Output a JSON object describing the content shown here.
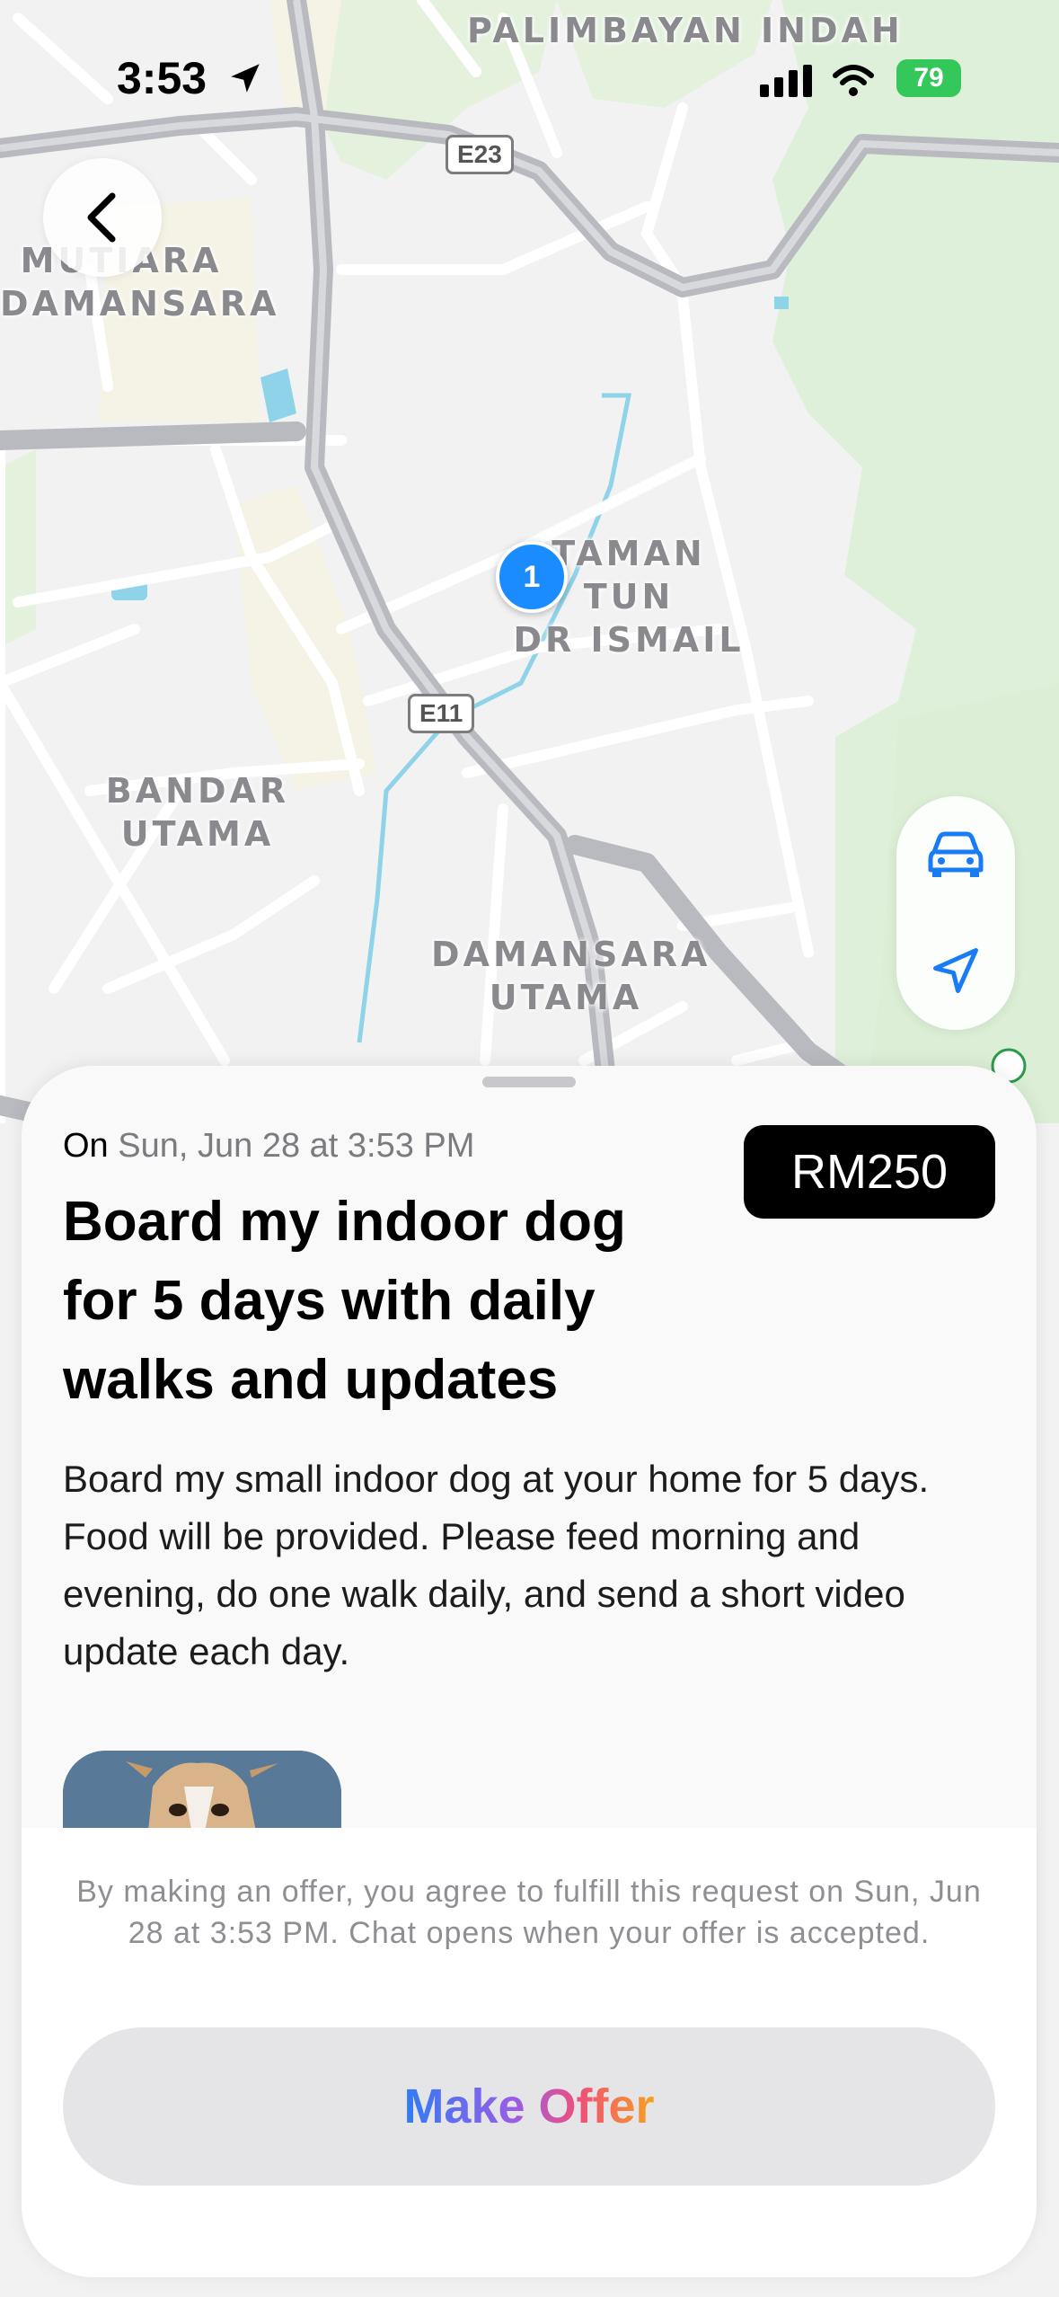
{
  "status_bar": {
    "time": "3:53",
    "battery": "79"
  },
  "map": {
    "labels": {
      "palimbayan": "PALIMBAYAN INDAH",
      "mutiara": "MUTIARA\nDAMANSARA",
      "taman_tun": "TAMAN TUN\nDR ISMAIL",
      "bandar_utama": "BANDAR\nUTAMA",
      "damansara_utama": "DAMANSARA\nUTAMA"
    },
    "roads": {
      "e23": "E23",
      "e11": "E11"
    },
    "pin_count": "1"
  },
  "request": {
    "date_prefix": "On",
    "date_text": "Sun, Jun 28 at 3:53 PM",
    "price": "RM250",
    "title": "Board my indoor dog for 5 days with daily walks and updates",
    "description": "Board my small indoor dog at your home for 5 days. Food will be provided. Please feed morning and evening, do one walk daily, and send a short video update each day."
  },
  "footer": {
    "disclaimer": "By making an offer, you agree to fulfill this request on Sun, Jun 28 at 3:53 PM. Chat opens when your offer is accepted.",
    "offer_button": "Make Offer"
  }
}
